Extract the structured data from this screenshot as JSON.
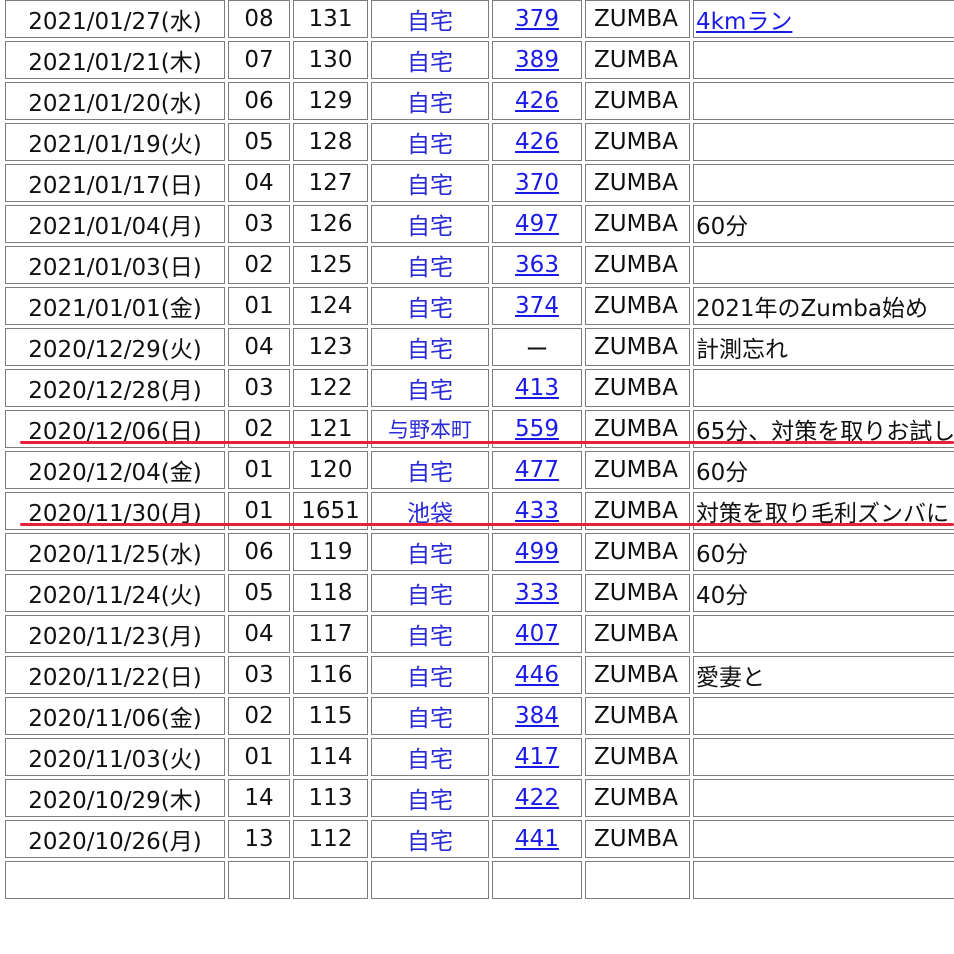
{
  "rows": [
    {
      "date": "2021/01/27(水)",
      "a": "08",
      "b": "131",
      "place": "自宅",
      "val": "379",
      "kind": "ZUMBA",
      "note": "4kmラン",
      "note_link": true
    },
    {
      "date": "2021/01/21(木)",
      "a": "07",
      "b": "130",
      "place": "自宅",
      "val": "389",
      "kind": "ZUMBA",
      "note": ""
    },
    {
      "date": "2021/01/20(水)",
      "a": "06",
      "b": "129",
      "place": "自宅",
      "val": "426",
      "kind": "ZUMBA",
      "note": ""
    },
    {
      "date": "2021/01/19(火)",
      "a": "05",
      "b": "128",
      "place": "自宅",
      "val": "426",
      "kind": "ZUMBA",
      "note": ""
    },
    {
      "date": "2021/01/17(日)",
      "a": "04",
      "b": "127",
      "place": "自宅",
      "val": "370",
      "kind": "ZUMBA",
      "note": ""
    },
    {
      "date": "2021/01/04(月)",
      "a": "03",
      "b": "126",
      "place": "自宅",
      "val": "497",
      "kind": "ZUMBA",
      "note": "60分"
    },
    {
      "date": "2021/01/03(日)",
      "a": "02",
      "b": "125",
      "place": "自宅",
      "val": "363",
      "kind": "ZUMBA",
      "note": ""
    },
    {
      "date": "2021/01/01(金)",
      "a": "01",
      "b": "124",
      "place": "自宅",
      "val": "374",
      "kind": "ZUMBA",
      "note": "2021年のZumba始め"
    },
    {
      "date": "2020/12/29(火)",
      "a": "04",
      "b": "123",
      "place": "自宅",
      "val": "ー",
      "kind": "ZUMBA",
      "note": "計測忘れ",
      "no_link": true
    },
    {
      "date": "2020/12/28(月)",
      "a": "03",
      "b": "122",
      "place": "自宅",
      "val": "413",
      "kind": "ZUMBA",
      "note": ""
    },
    {
      "date": "2020/12/06(日)",
      "a": "02",
      "b": "121",
      "place": "与野本町",
      "val": "559",
      "kind": "ZUMBA",
      "note": "65分、対策を取りお試し",
      "highlight": true,
      "small_place": true
    },
    {
      "date": "2020/12/04(金)",
      "a": "01",
      "b": "120",
      "place": "自宅",
      "val": "477",
      "kind": "ZUMBA",
      "note": "60分"
    },
    {
      "date": "2020/11/30(月)",
      "a": "01",
      "b": "1651",
      "place": "池袋",
      "val": "433",
      "kind": "ZUMBA",
      "note": "対策を取り毛利ズンバに",
      "highlight": true
    },
    {
      "date": "2020/11/25(水)",
      "a": "06",
      "b": "119",
      "place": "自宅",
      "val": "499",
      "kind": "ZUMBA",
      "note": "60分"
    },
    {
      "date": "2020/11/24(火)",
      "a": "05",
      "b": "118",
      "place": "自宅",
      "val": "333",
      "kind": "ZUMBA",
      "note": "40分"
    },
    {
      "date": "2020/11/23(月)",
      "a": "04",
      "b": "117",
      "place": "自宅",
      "val": "407",
      "kind": "ZUMBA",
      "note": ""
    },
    {
      "date": "2020/11/22(日)",
      "a": "03",
      "b": "116",
      "place": "自宅",
      "val": "446",
      "kind": "ZUMBA",
      "note": "愛妻と"
    },
    {
      "date": "2020/11/06(金)",
      "a": "02",
      "b": "115",
      "place": "自宅",
      "val": "384",
      "kind": "ZUMBA",
      "note": ""
    },
    {
      "date": "2020/11/03(火)",
      "a": "01",
      "b": "114",
      "place": "自宅",
      "val": "417",
      "kind": "ZUMBA",
      "note": ""
    },
    {
      "date": "2020/10/29(木)",
      "a": "14",
      "b": "113",
      "place": "自宅",
      "val": "422",
      "kind": "ZUMBA",
      "note": ""
    },
    {
      "date": "2020/10/26(月)",
      "a": "13",
      "b": "112",
      "place": "自宅",
      "val": "441",
      "kind": "ZUMBA",
      "note": ""
    },
    {
      "date": "",
      "a": "",
      "b": "",
      "place": "",
      "val": "",
      "kind": "",
      "note": "",
      "partial": true
    }
  ],
  "colors": {
    "highlight_line": "#e8203a",
    "link": "#1a1ae6",
    "place": "#2a2ad6",
    "border": "#7d7d7d"
  }
}
